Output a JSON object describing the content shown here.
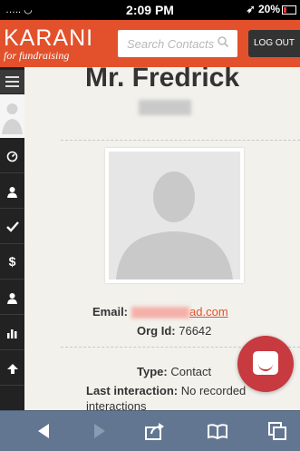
{
  "status_bar": {
    "carrier": "…..",
    "time": "2:09 PM",
    "battery": "20%"
  },
  "header": {
    "logo_main": "KARANI",
    "logo_sub": "for fundraising",
    "search_placeholder": "Search Contacts",
    "logout_label": "LOG OUT"
  },
  "contact": {
    "name": "Mr. Fredrick",
    "email_label": "Email:",
    "email_visible": "ad.com",
    "orgid_label": "Org Id:",
    "orgid_value": "76642",
    "type_label": "Type:",
    "type_value": "Contact",
    "last_interaction_label": "Last interaction:",
    "last_interaction_value": "No recorded interactions"
  },
  "sidebar": {
    "icons": [
      "gauge-icon",
      "person-icon",
      "check-icon",
      "dollar-icon",
      "people-icon",
      "bar-chart-icon",
      "upload-icon"
    ],
    "dollar_glyph": "$"
  },
  "colors": {
    "brand": "#e2512b",
    "sidebar": "#222222",
    "fab": "#c73a3f",
    "toolbar": "#627691"
  }
}
